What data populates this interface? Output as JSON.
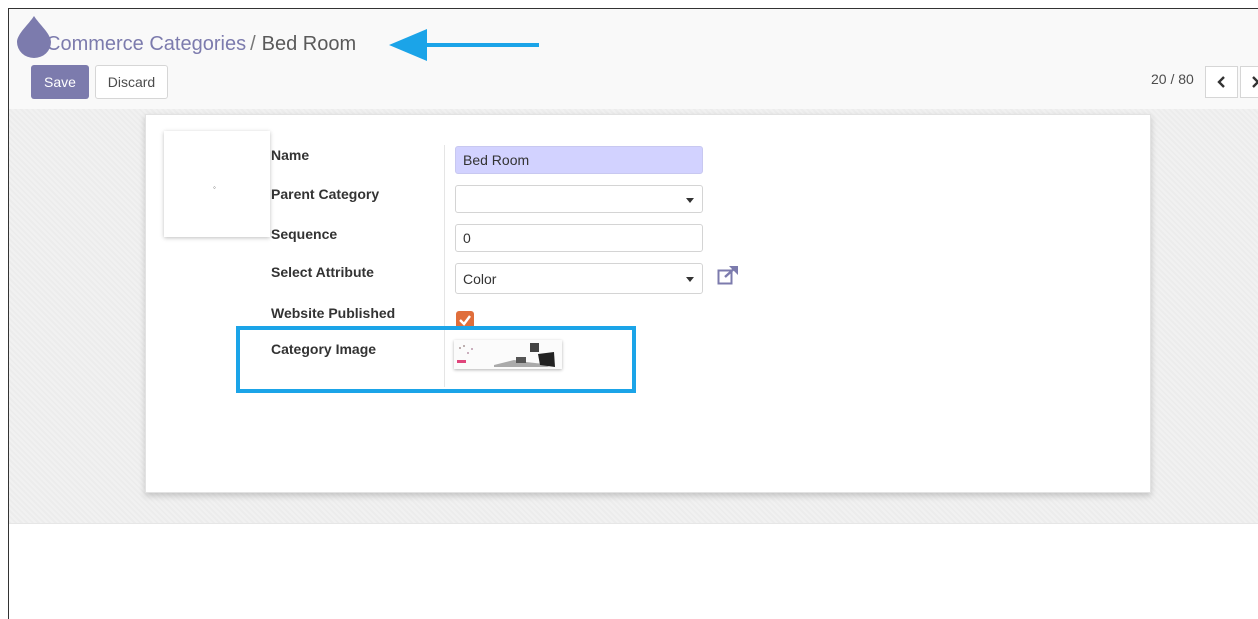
{
  "breadcrumb": {
    "parent_label": "Commerce Categories",
    "separator": "/",
    "current_label": "Bed Room"
  },
  "toolbar": {
    "save_label": "Save",
    "discard_label": "Discard"
  },
  "pager": {
    "value": "20 / 80",
    "prev_icon": "chevron-left-icon",
    "next_icon": "chevron-right-icon"
  },
  "form": {
    "name": {
      "label": "Name",
      "value": "Bed Room"
    },
    "parent_category": {
      "label": "Parent Category",
      "value": ""
    },
    "sequence": {
      "label": "Sequence",
      "value": "0"
    },
    "select_attribute": {
      "label": "Select Attribute",
      "value": "Color"
    },
    "website_published": {
      "label": "Website Published",
      "checked": true
    },
    "category_image": {
      "label": "Category Image"
    }
  },
  "colors": {
    "brand": "#7c7bad",
    "required_field": "#d2d2ff",
    "checkbox": "#e06e3b",
    "annotation": "#1ba4e8"
  },
  "annotations": {
    "arrow": "arrow-left-icon",
    "highlight": "category-image-highlight"
  }
}
